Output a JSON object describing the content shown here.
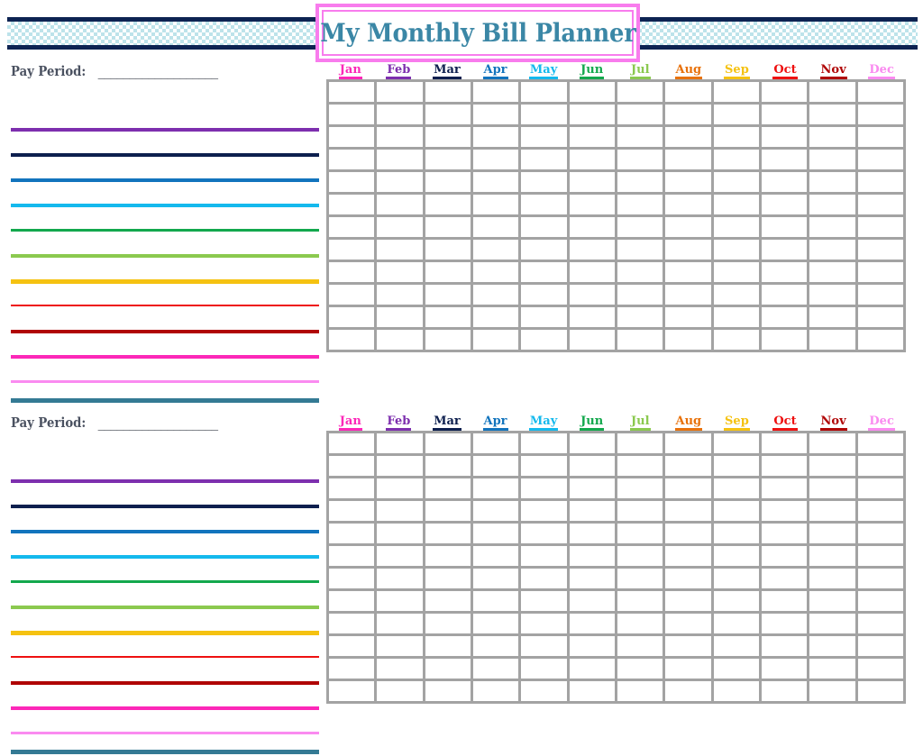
{
  "document": {
    "title": "My Monthly Bill Planner",
    "accent_pink": "#f87ced",
    "title_color": "#3b87a6",
    "banner_border": "#0d2352",
    "banner_check": "#bde3ea",
    "grid_border": "#a3a3a3",
    "divider_color": "#347a94"
  },
  "months": [
    {
      "label": "Jan",
      "color": "#fc28b8"
    },
    {
      "label": "Feb",
      "color": "#7d2fae"
    },
    {
      "label": "Mar",
      "color": "#0d1f4e"
    },
    {
      "label": "Apr",
      "color": "#1274bd"
    },
    {
      "label": "May",
      "color": "#14b9ed"
    },
    {
      "label": "Jun",
      "color": "#13a84d"
    },
    {
      "label": "Jul",
      "color": "#8bc94f"
    },
    {
      "label": "Aug",
      "color": "#e8720c"
    },
    {
      "label": "Sep",
      "color": "#f5c211"
    },
    {
      "label": "Oct",
      "color": "#ee1111"
    },
    {
      "label": "Nov",
      "color": "#b00505"
    },
    {
      "label": "Dec",
      "color": "#fa8bf0"
    }
  ],
  "bill_line_colors": [
    {
      "color": "#7d2fae",
      "thickness": 4
    },
    {
      "color": "#0d1f4e",
      "thickness": 4
    },
    {
      "color": "#1274bd",
      "thickness": 4
    },
    {
      "color": "#14b9ed",
      "thickness": 4
    },
    {
      "color": "#13a84d",
      "thickness": 3
    },
    {
      "color": "#8bc94f",
      "thickness": 4
    },
    {
      "color": "#f5c211",
      "thickness": 5
    },
    {
      "color": "#ee1111",
      "thickness": 2
    },
    {
      "color": "#b00505",
      "thickness": 4
    },
    {
      "color": "#fc28b8",
      "thickness": 4
    },
    {
      "color": "#fa8bf0",
      "thickness": 3
    }
  ],
  "grid": {
    "columns": 12,
    "rows": 12
  },
  "sections": [
    {
      "pay_period_label": "Pay Period:",
      "pay_period_blank": "___________________"
    },
    {
      "pay_period_label": "Pay Period:",
      "pay_period_blank": "___________________"
    }
  ]
}
